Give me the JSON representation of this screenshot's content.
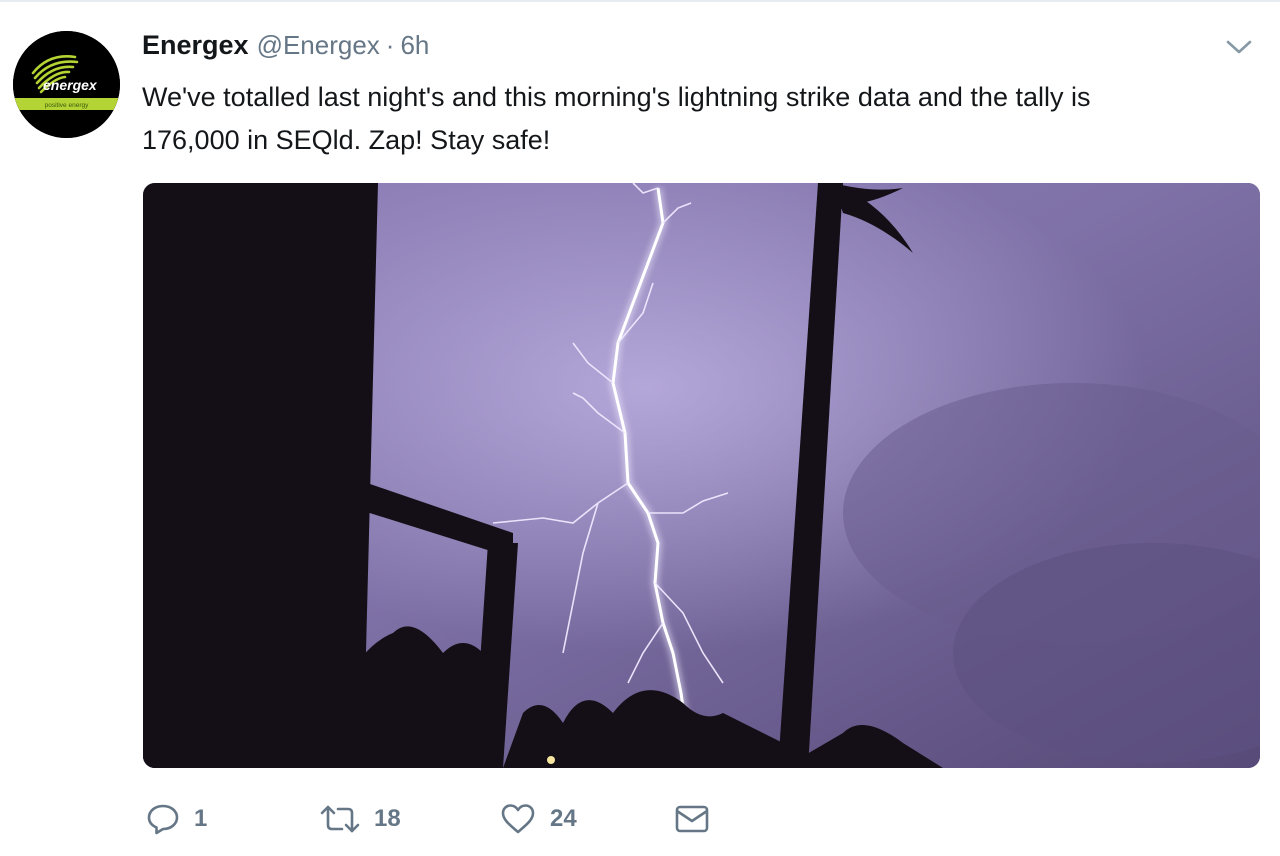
{
  "tweet": {
    "author": {
      "display_name": "Energex",
      "handle": "@Energex",
      "logo_text": "energex",
      "logo_tagline": "positive energy"
    },
    "separator": "·",
    "timestamp": "6h",
    "text_lines": [
      "We've totalled last night's and this morning's lightning strike data and the tally is",
      "176,000 in SEQld. Zap! Stay safe!"
    ],
    "media": {
      "kind": "photo",
      "subject": "lightning-strike-purple-sky"
    },
    "actions": {
      "reply": {
        "icon": "reply-icon",
        "count": "1"
      },
      "retweet": {
        "icon": "retweet-icon",
        "count": "18"
      },
      "like": {
        "icon": "heart-icon",
        "count": "24"
      },
      "message": {
        "icon": "envelope-icon"
      }
    }
  },
  "colors": {
    "text_primary": "#14171a",
    "text_secondary": "#657786",
    "logo_green": "#b4d334",
    "sky": "#8a7cb2"
  }
}
